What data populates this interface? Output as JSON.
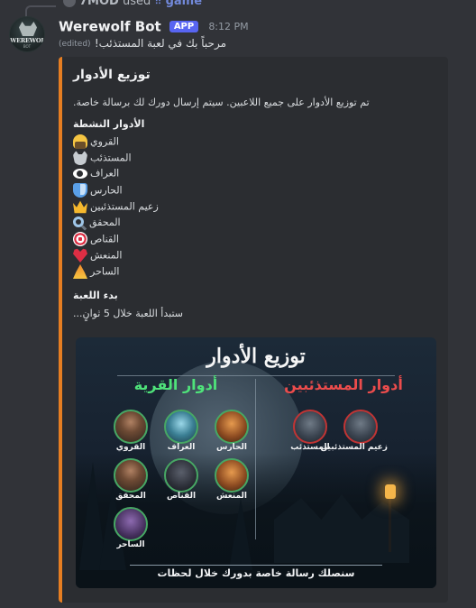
{
  "reply": {
    "username": "7MOD",
    "used_text": "used",
    "command": "game"
  },
  "message": {
    "bot_name": "Werewolf Bot",
    "app_badge": "APP",
    "time": "8:12 PM",
    "edited": "(edited)",
    "text": "مرحباً بك في لعبة المستذئب!",
    "avatar_text": "WEREWOLF",
    "avatar_subtext": "BOT"
  },
  "embed": {
    "accent_color": "#e67e22",
    "title": "توزيع الأدوار",
    "description": "تم توزيع الأدوار على جميع اللاعبين. سيتم إرسال دورك لك برسالة خاصة.",
    "active_roles_title": "الأدوار النشطة",
    "roles": [
      {
        "icon": "farmer-icon",
        "label": "القروي"
      },
      {
        "icon": "wolf-icon",
        "label": "المستذئب"
      },
      {
        "icon": "eye-icon",
        "label": "العراف"
      },
      {
        "icon": "shield-icon",
        "label": "الحارس"
      },
      {
        "icon": "crown-icon",
        "label": "زعيم المستذئبين"
      },
      {
        "icon": "magnifier-icon",
        "label": "المحقق"
      },
      {
        "icon": "target-icon",
        "label": "القناص"
      },
      {
        "icon": "heart-icon",
        "label": "المنعش"
      },
      {
        "icon": "mage-icon",
        "label": "الساحر"
      }
    ],
    "start_title": "بدء اللعبة",
    "start_text": "ستبدأ اللعبة خلال 5 ثوانٍ..."
  },
  "image": {
    "title": "توزيع الأدوار",
    "village_heading": "أدوار القرية",
    "wolves_heading": "أدوار المستذئبين",
    "village_roles": [
      "القروي",
      "العراف",
      "الحارس",
      "المحقق",
      "القناص",
      "المنعش",
      "الساحر"
    ],
    "wolf_roles": [
      "المستذئب",
      "زعيم المستذئبين"
    ],
    "footer": "سنصلك رسالة خاصة بدورك خلال لحظات"
  }
}
